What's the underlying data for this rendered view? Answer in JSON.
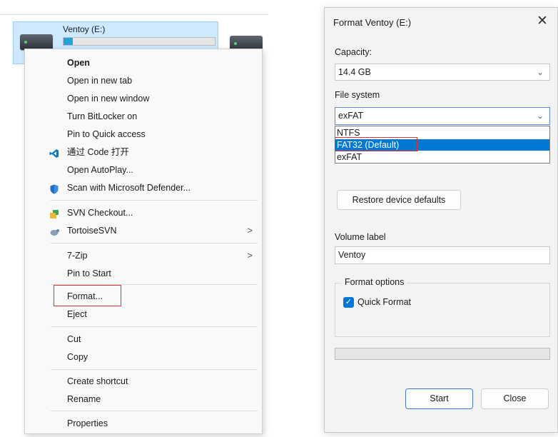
{
  "explorer": {
    "drive_name": "Ventoy (E:)",
    "drive_usage_fraction": 0.06
  },
  "context_menu": {
    "items": [
      {
        "label": "Open",
        "bold": true
      },
      {
        "label": "Open in new tab"
      },
      {
        "label": "Open in new window"
      },
      {
        "label": "Turn BitLocker on"
      },
      {
        "label": "Pin to Quick access"
      },
      {
        "label": "通过 Code 打开",
        "icon": "vscode-icon"
      },
      {
        "label": "Open AutoPlay..."
      },
      {
        "label": "Scan with Microsoft Defender...",
        "icon": "defender-shield-icon"
      },
      {
        "label": "SVN Checkout...",
        "icon": "svn-checkout-icon"
      },
      {
        "label": "TortoiseSVN",
        "icon": "tortoisesvn-icon",
        "submenu": true
      },
      {
        "label": "7-Zip",
        "submenu": true
      },
      {
        "label": "Pin to Start"
      },
      {
        "label": "Format...",
        "highlighted": true
      },
      {
        "label": "Eject"
      },
      {
        "label": "Cut"
      },
      {
        "label": "Copy"
      },
      {
        "label": "Create shortcut"
      },
      {
        "label": "Rename"
      },
      {
        "label": "Properties"
      }
    ],
    "submenu_arrow": ">"
  },
  "dialog": {
    "title": "Format Ventoy (E:)",
    "close_glyph": "✕",
    "capacity_label": "Capacity:",
    "capacity_value": "14.4 GB",
    "filesystem_label": "File system",
    "filesystem_value": "exFAT",
    "filesystem_options": [
      "NTFS",
      "FAT32 (Default)",
      "exFAT"
    ],
    "filesystem_highlighted_option": "FAT32 (Default)",
    "restore_button": "Restore device defaults",
    "volume_label_label": "Volume label",
    "volume_label_value": "Ventoy",
    "format_options_title": "Format options",
    "quick_format_label": "Quick Format",
    "quick_format_checked": true,
    "progress_fraction": 0,
    "start_button": "Start",
    "close_button": "Close",
    "chevron_glyph": "⌄"
  },
  "colors": {
    "accent": "#0078d4",
    "highlight_border": "#e03131",
    "selection_tile": "#cde8ff"
  }
}
